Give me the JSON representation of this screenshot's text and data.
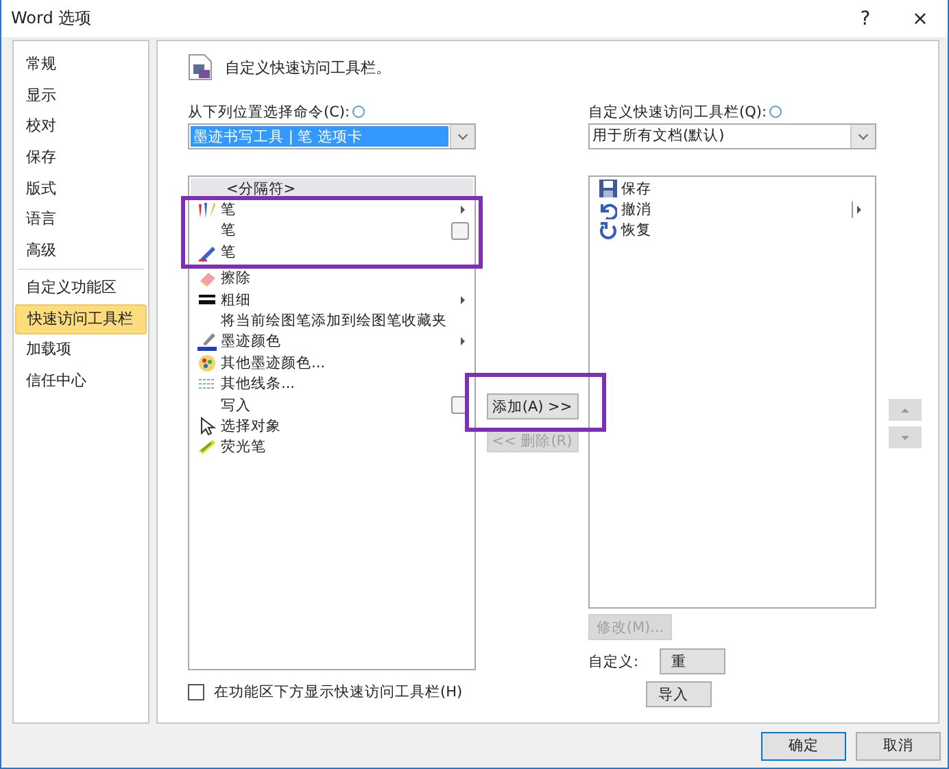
{
  "window": {
    "title": "Word 选项",
    "help": "?",
    "close": "×"
  },
  "sidebar": {
    "items": [
      {
        "label": "常规",
        "selected": false
      },
      {
        "label": "显示",
        "selected": false
      },
      {
        "label": "校对",
        "selected": false
      },
      {
        "label": "保存",
        "selected": false
      },
      {
        "label": "版式",
        "selected": false
      },
      {
        "label": "语言",
        "selected": false
      },
      {
        "label": "高级",
        "selected": false,
        "divider_after": true
      },
      {
        "label": "自定义功能区",
        "selected": false
      },
      {
        "label": "快速访问工具栏",
        "selected": true
      },
      {
        "label": "加载项",
        "selected": false
      },
      {
        "label": "信任中心",
        "selected": false
      }
    ]
  },
  "header": "自定义快速访问工具栏。",
  "source": {
    "label": "从下列位置选择命令(C):",
    "dropdown": "墨迹书写工具 | 笔 选项卡"
  },
  "commands": [
    {
      "label": "<分隔符>",
      "kind": "separator",
      "submenu": false,
      "dropdown": false
    },
    {
      "label": "笔",
      "kind": "pens",
      "submenu": true,
      "dropdown": false
    },
    {
      "label": "笔",
      "kind": "plain",
      "submenu": false,
      "dropdown": true
    },
    {
      "label": "笔",
      "kind": "pen",
      "submenu": false,
      "dropdown": false
    },
    {
      "label": "擦除",
      "kind": "eraser",
      "submenu": false,
      "dropdown": false
    },
    {
      "label": "粗细",
      "kind": "lines",
      "submenu": true,
      "dropdown": false
    },
    {
      "label": "将当前绘图笔添加到绘图笔收藏夹",
      "kind": "plain",
      "submenu": false,
      "dropdown": false
    },
    {
      "label": "墨迹颜色",
      "kind": "ink",
      "submenu": true,
      "dropdown": false
    },
    {
      "label": "其他墨迹颜色...",
      "kind": "palette",
      "submenu": false,
      "dropdown": false
    },
    {
      "label": "其他线条...",
      "kind": "dashes",
      "submenu": false,
      "dropdown": false
    },
    {
      "label": "写入",
      "kind": "plain",
      "submenu": false,
      "dropdown": true
    },
    {
      "label": "选择对象",
      "kind": "cursor",
      "submenu": false,
      "dropdown": false
    },
    {
      "label": "荧光笔",
      "kind": "highlighter",
      "submenu": false,
      "dropdown": false
    }
  ],
  "add_button": "添加(A) >>",
  "remove_button": {
    "label": "<< 删除(R)",
    "disabled": true
  },
  "target": {
    "label": "自定义快速访问工具栏(Q):",
    "dropdown": "用于所有文档(默认)"
  },
  "toolbar_items": [
    {
      "label": "保存",
      "kind": "save",
      "split": false
    },
    {
      "label": "撤消",
      "kind": "undo",
      "split": true
    },
    {
      "label": "恢复",
      "kind": "redo",
      "split": false
    }
  ],
  "modify_button": {
    "label": "修改(M)...",
    "disabled": true
  },
  "customize_label": "自定义:",
  "reset_button": "重",
  "import_button": "导入",
  "show_below": {
    "label": "在功能区下方显示快速访问工具栏(H)",
    "checked": false
  },
  "ok_button": "确定",
  "cancel_button": "取消"
}
